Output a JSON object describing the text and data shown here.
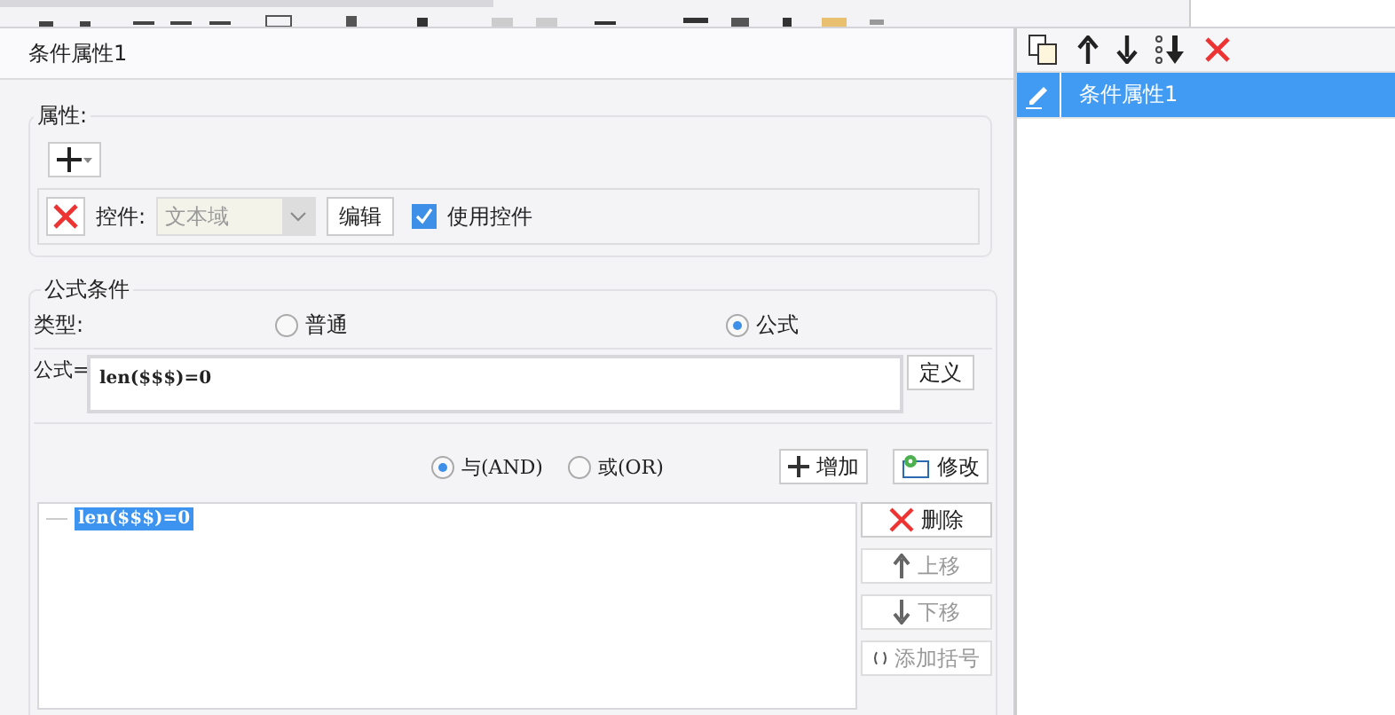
{
  "dialog": {
    "title": "条件属性1"
  },
  "properties": {
    "legend": "属性:",
    "widget_label": "控件:",
    "widget_select": {
      "value": "文本域",
      "disabled": true
    },
    "edit_button": "编辑",
    "use_widget": {
      "label": "使用控件",
      "checked": true
    }
  },
  "formula_condition": {
    "legend": "公式条件",
    "type_label": "类型:",
    "types": [
      {
        "label": "普通",
        "selected": false
      },
      {
        "label": "公式",
        "selected": true
      }
    ],
    "formula_label": "公式=",
    "formula_value": "len($$$)=0",
    "define_button": "定义",
    "logic": [
      {
        "label": "与(AND)",
        "selected": true
      },
      {
        "label": "或(OR)",
        "selected": false
      }
    ],
    "add_button": "增加",
    "modify_button": "修改",
    "conditions": [
      {
        "label": "len($$$)=0",
        "selected": true
      }
    ],
    "actions": [
      {
        "label": "删除",
        "kind": "delete",
        "disabled": false
      },
      {
        "label": "上移",
        "kind": "up",
        "disabled": true
      },
      {
        "label": "下移",
        "kind": "down",
        "disabled": true
      },
      {
        "label": "添加括号",
        "kind": "bracket",
        "disabled": true
      }
    ]
  },
  "condition_list": [
    {
      "label": "条件属性1",
      "selected": true
    }
  ]
}
